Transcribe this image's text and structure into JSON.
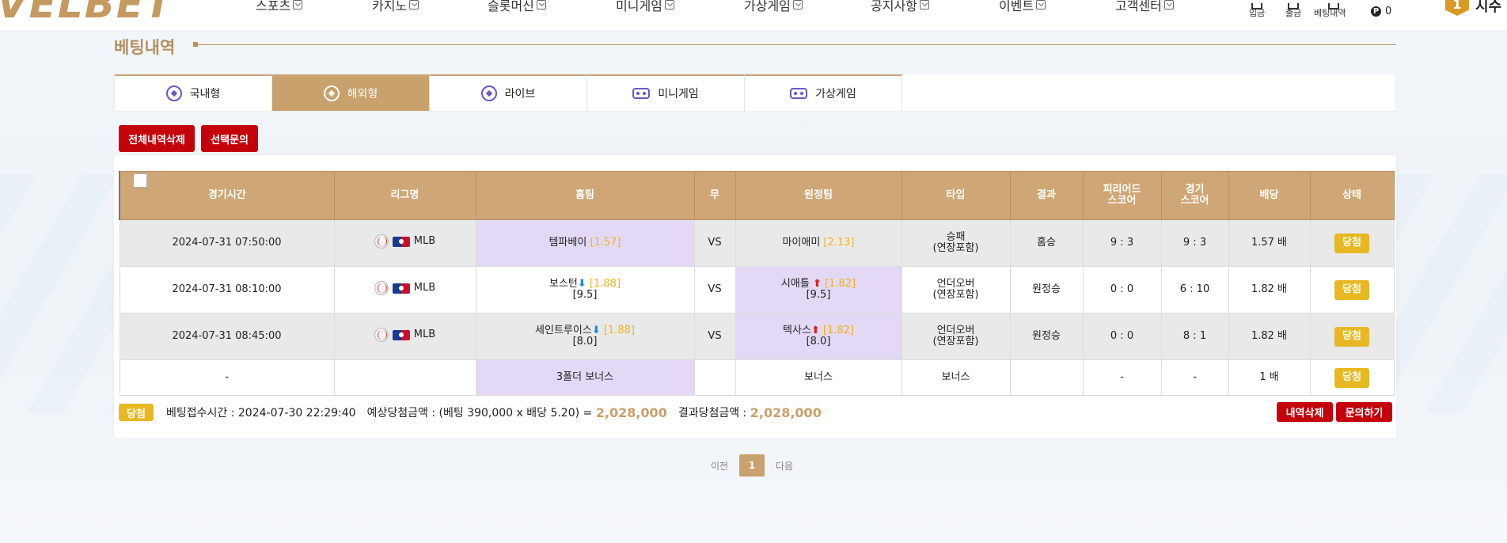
{
  "header": {
    "logo": "VELBET",
    "nav": [
      "스포츠",
      "카지노",
      "슬롯머신",
      "미니게임",
      "가상게임",
      "공지사항",
      "이벤트",
      "고객센터"
    ],
    "util": [
      "입금",
      "출금",
      "베팅내역"
    ],
    "coin_count": "0",
    "level": "1",
    "user": "시수"
  },
  "title": "베팅내역",
  "tabs": [
    {
      "label": "국내형",
      "icon": "soccer-icon"
    },
    {
      "label": "해외형",
      "icon": "soccer-icon",
      "active": true
    },
    {
      "label": "라이브",
      "icon": "soccer-icon"
    },
    {
      "label": "미니게임",
      "icon": "gamepad-icon"
    },
    {
      "label": "가상게임",
      "icon": "gamepad-icon"
    }
  ],
  "actions": {
    "delete_all": "전체내역삭제",
    "inquire_selected": "선택문의"
  },
  "table": {
    "headers": [
      "경기시간",
      "리그명",
      "홈팀",
      "무",
      "원정팀",
      "타입",
      "결과",
      "피리어드\n스코어",
      "경기\n스코어",
      "배당",
      "상태"
    ],
    "rows": [
      {
        "time": "2024-07-31 07:50:00",
        "league": "MLB",
        "home": "템파베이",
        "home_odd": "[1.57]",
        "home_arrow": "",
        "home_line": "",
        "draw": "VS",
        "away": "마이애미",
        "away_odd": "[2.13]",
        "away_arrow": "",
        "away_line": "",
        "type1": "승패",
        "type2": "(연장포함)",
        "result": "홈승",
        "period": "9 : 3",
        "game": "9 : 3",
        "odds": "1.57 배",
        "status": "당첨"
      },
      {
        "time": "2024-07-31 08:10:00",
        "league": "MLB",
        "home": "보스턴",
        "home_odd": "[1.88]",
        "home_arrow": "⬇",
        "home_line": "[9.5]",
        "draw": "VS",
        "away": "시애틀",
        "away_odd": "[1.82]",
        "away_arrow": "⬆",
        "away_line": "[9.5]",
        "type1": "언더오버",
        "type2": "(연장포함)",
        "result": "원정승",
        "period": "0 : 0",
        "game": "6 : 10",
        "odds": "1.82 배",
        "status": "당첨"
      },
      {
        "time": "2024-07-31 08:45:00",
        "league": "MLB",
        "home": "세인트루이스",
        "home_odd": "[1.88]",
        "home_arrow": "⬇",
        "home_line": "[8.0]",
        "draw": "VS",
        "away": "텍사스",
        "away_odd": "[1.82]",
        "away_arrow": "⬆",
        "away_line": "[8.0]",
        "type1": "언더오버",
        "type2": "(연장포함)",
        "result": "원정승",
        "period": "0 : 0",
        "game": "8 : 1",
        "odds": "1.82 배",
        "status": "당첨"
      },
      {
        "time": "-",
        "league": "",
        "home": "3폴더 보너스",
        "draw": "",
        "away": "보너스",
        "type1": "보너스",
        "result": "",
        "period": "-",
        "game": "-",
        "odds": "1 배",
        "status": "당첨"
      }
    ]
  },
  "summary": {
    "status": "당첨",
    "receipt_label": "베팅접수시간 : 2024-07-30 22:29:40",
    "expected_label": "예상당첨금액 : (베팅 390,000 x 배당 5.20) =",
    "expected_amount": "2,028,000",
    "result_label": "결과당첨금액 :",
    "result_amount": "2,028,000",
    "delete_btn": "내역삭제",
    "inquire_btn": "문의하기"
  },
  "pager": {
    "prev": "이전",
    "page": "1",
    "next": "다음"
  },
  "colors": {
    "accent": "#c9a16d",
    "gold": "#e7b823",
    "red": "#c4000b",
    "highlight": "#e3d9f6"
  }
}
